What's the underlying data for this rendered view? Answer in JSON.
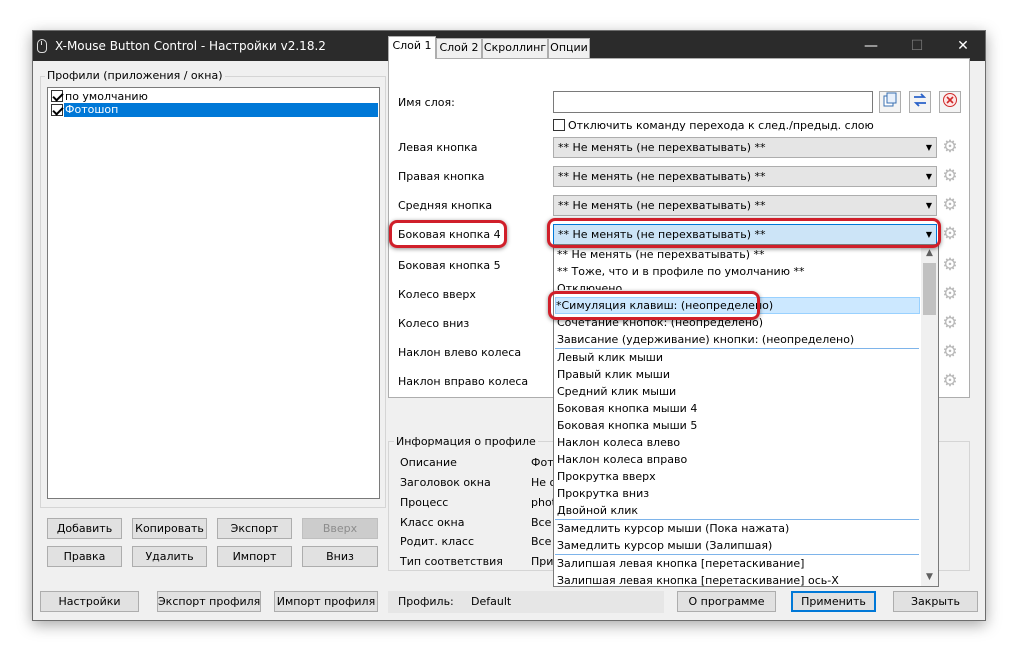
{
  "window": {
    "title": "X-Mouse Button Control - Настройки v2.18.2",
    "controls": {
      "minimize": "—",
      "maximize": "☐",
      "close": "✕"
    }
  },
  "profiles": {
    "group_label": "Профили (приложения / окна)",
    "items": [
      {
        "label": "по умолчанию",
        "checked": true,
        "selected": false
      },
      {
        "label": "Фотошоп",
        "checked": true,
        "selected": true
      }
    ],
    "buttons": {
      "add": "Добавить",
      "copy": "Копировать",
      "export": "Экспорт",
      "up": "Вверх",
      "edit": "Правка",
      "delete": "Удалить",
      "import": "Импорт",
      "down": "Вниз"
    }
  },
  "tabs": [
    "Слой 1",
    "Слой 2",
    "Скроллинг",
    "Опции"
  ],
  "layer": {
    "name_label": "Имя слоя:",
    "name_value": "",
    "disable_checkbox_label": "Отключить команду перехода к след./предыд. слою",
    "icons": {
      "copy": "copy-icon",
      "swap": "swap-icon",
      "clear": "clear-icon"
    },
    "rows": [
      {
        "label": "Левая кнопка",
        "value": "** Не менять (не перехватывать) **"
      },
      {
        "label": "Правая кнопка",
        "value": "** Не менять (не перехватывать) **"
      },
      {
        "label": "Средняя кнопка",
        "value": "** Не менять (не перехватывать) **"
      },
      {
        "label": "Боковая кнопка 4",
        "value": "** Не менять (не перехватывать) **"
      },
      {
        "label": "Боковая кнопка 5",
        "value": ""
      },
      {
        "label": "Колесо вверх",
        "value": ""
      },
      {
        "label": "Колесо вниз",
        "value": ""
      },
      {
        "label": "Наклон влево колеса",
        "value": ""
      },
      {
        "label": "Наклон вправо колеса",
        "value": ""
      }
    ]
  },
  "dropdown": {
    "items": [
      "** Не менять (не перехватывать) **",
      "** Тоже, что и в профиле по умолчанию **",
      "Отключено",
      "*Симуляция клавиш: (неопределено)",
      "Сочетание кнопок: (неопределено)",
      "Зависание (удерживание) кнопки: (неопределено)",
      "Левый клик мыши",
      "Правый клик мыши",
      "Средний клик мыши",
      "Боковая кнопка мыши 4",
      "Боковая кнопка мыши 5",
      "Наклон колеса влево",
      "Наклон колеса вправо",
      "Прокрутка вверх",
      "Прокрутка вниз",
      "Двойной клик",
      "Замедлить курсор мыши (Пока нажата)",
      "Замедлить курсор мыши (Залипшая)",
      "Залипшая левая кнопка [перетаскивание]",
      "Залипшая левая кнопка [перетаскивание] ось-X"
    ],
    "selected_index": 3
  },
  "info": {
    "group_label": "Информация о профиле",
    "rows": [
      {
        "label": "Описание",
        "value": "Фото"
      },
      {
        "label": "Заголовок окна",
        "value": "Не о"
      },
      {
        "label": "Процесс",
        "value": "phot"
      },
      {
        "label": "Класс окна",
        "value": "Все"
      },
      {
        "label": "Родит. класс",
        "value": "Все"
      },
      {
        "label": "Тип соответствия",
        "value": "При"
      }
    ]
  },
  "footer": {
    "settings": "Настройки",
    "export_profile": "Экспорт профиля",
    "import_profile": "Импорт профиля",
    "profile_label": "Профиль:",
    "profile_value": "Default",
    "about": "О программе",
    "apply": "Применить",
    "close": "Закрыть"
  },
  "colors": {
    "highlight": "#d01f2a",
    "selection": "#0078d7",
    "titlebar": "#2b2b2b"
  }
}
